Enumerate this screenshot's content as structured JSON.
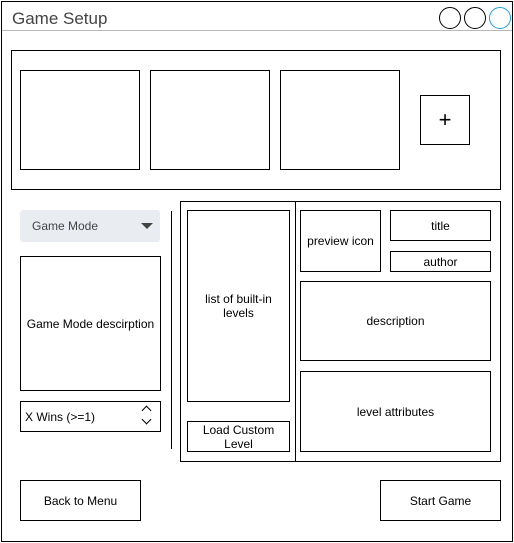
{
  "window": {
    "title": "Game Setup",
    "controls": [
      "minimize-button",
      "maximize-button",
      "close-button"
    ],
    "close_color": "#1ba1e2"
  },
  "carousel": {
    "slots": [
      "",
      "",
      ""
    ],
    "add_label": "+"
  },
  "game_mode": {
    "selected": "Game Mode",
    "description": "Game Mode descirption",
    "wins_label": "X Wins (>=1)"
  },
  "levels": {
    "list_label": "list of built-in levels",
    "load_custom": "Load Custom Level",
    "preview_icon": "preview icon",
    "title": "title",
    "author": "author",
    "description": "description",
    "attributes": "level attributes"
  },
  "footer": {
    "back": "Back to Menu",
    "start": "Start Game"
  },
  "colors": {
    "select_bg": "#e9ecf1",
    "title_text": "#444444"
  }
}
